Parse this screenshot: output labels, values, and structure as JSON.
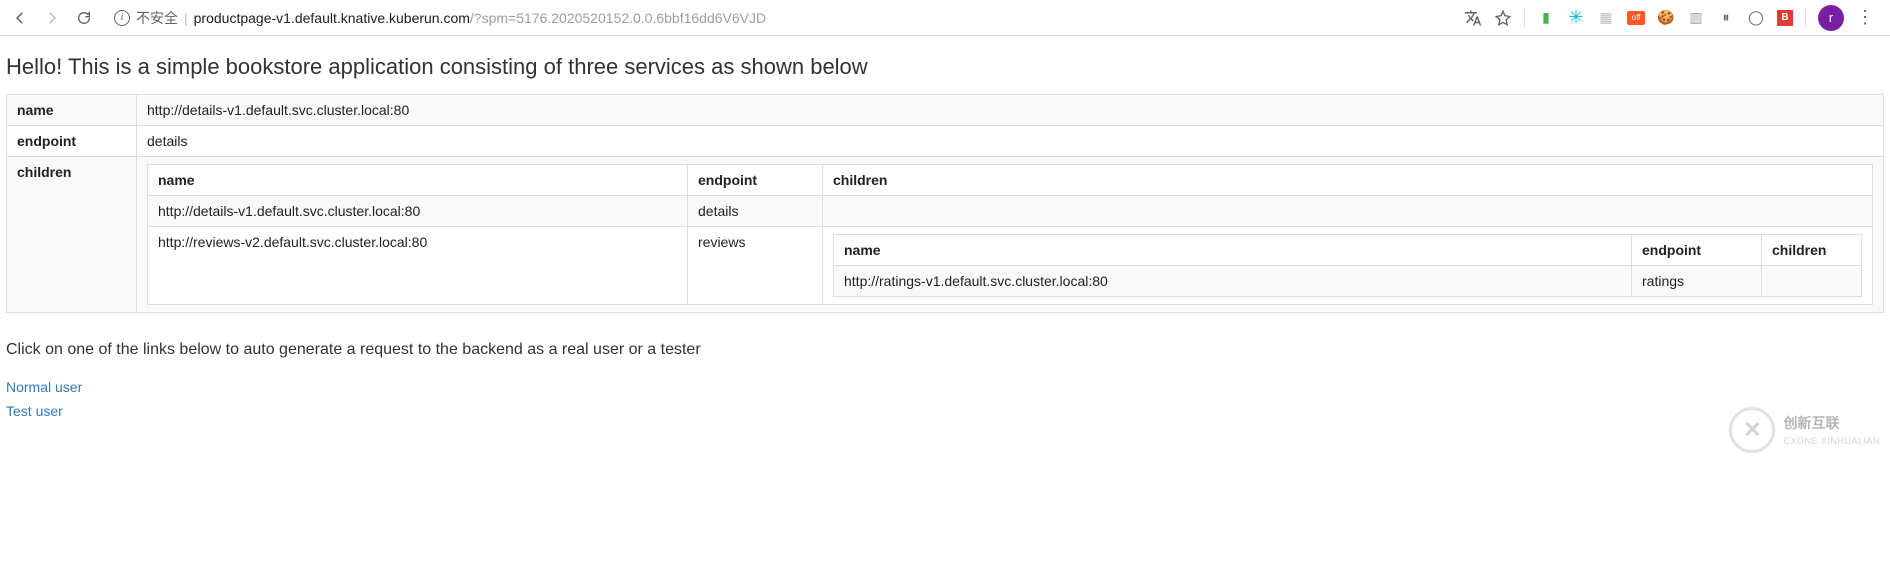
{
  "browser": {
    "insecure_label": "不安全",
    "url_host": "productpage-v1.default.knative.kuberun.com",
    "url_rest": "/?spm=5176.2020520152.0.0.6bbf16dd6V6VJD",
    "avatar_letter": "r"
  },
  "page": {
    "heading": "Hello! This is a simple bookstore application consisting of three services as shown below",
    "labels": {
      "name": "name",
      "endpoint": "endpoint",
      "children": "children"
    },
    "root": {
      "name": "http://details-v1.default.svc.cluster.local:80",
      "endpoint": "details"
    },
    "children_table": {
      "headers": {
        "name": "name",
        "endpoint": "endpoint",
        "children": "children"
      },
      "rows": [
        {
          "name": "http://details-v1.default.svc.cluster.local:80",
          "endpoint": "details",
          "children": null
        },
        {
          "name": "http://reviews-v2.default.svc.cluster.local:80",
          "endpoint": "reviews",
          "children": {
            "headers": {
              "name": "name",
              "endpoint": "endpoint",
              "children": "children"
            },
            "rows": [
              {
                "name": "http://ratings-v1.default.svc.cluster.local:80",
                "endpoint": "ratings",
                "children": ""
              }
            ]
          }
        }
      ]
    },
    "subheading": "Click on one of the links below to auto generate a request to the backend as a real user or a tester",
    "links": {
      "normal_user": "Normal user",
      "test_user": "Test user"
    }
  },
  "watermark": {
    "title": "创新互联",
    "sub": "CXONE XINHUALIAN"
  }
}
